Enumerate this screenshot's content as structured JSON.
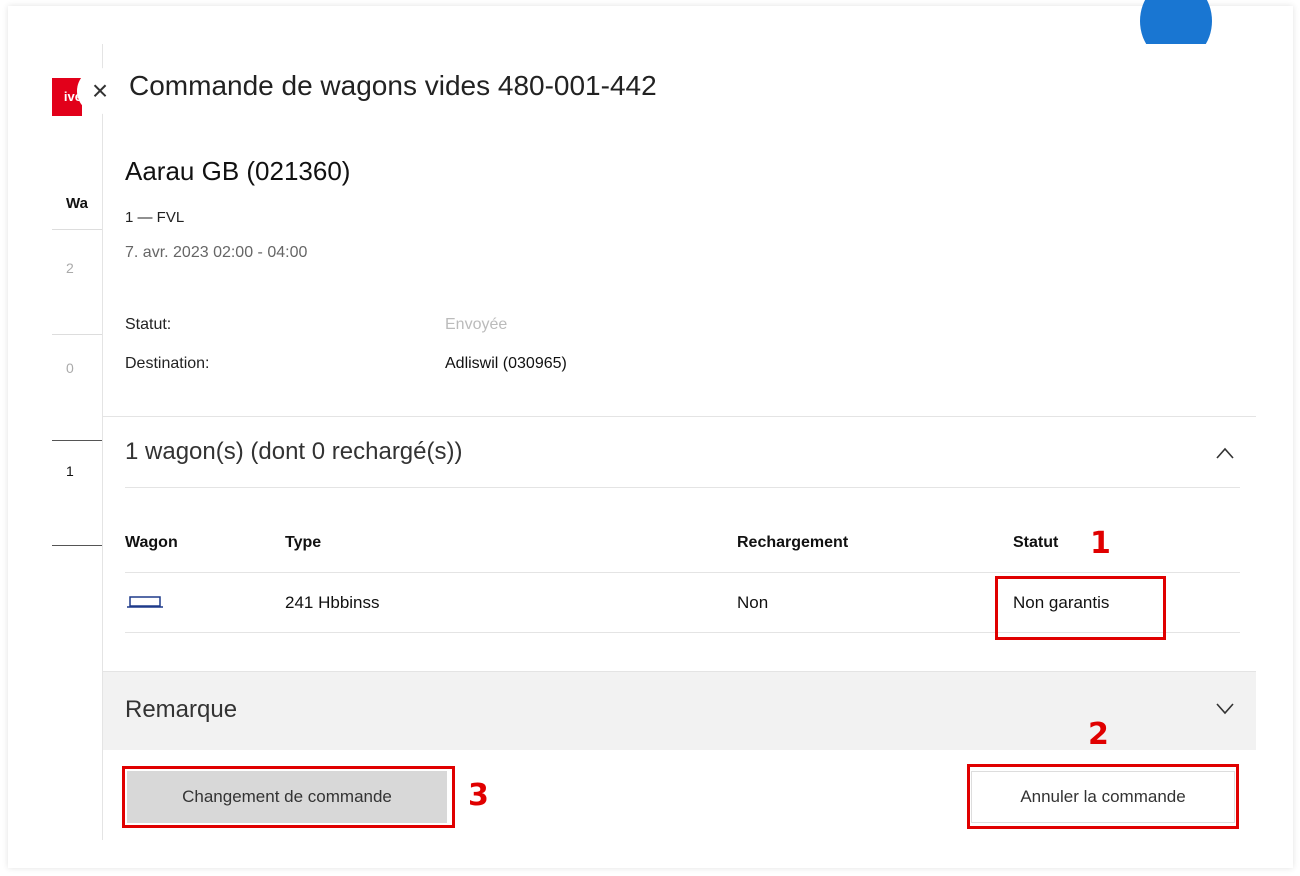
{
  "background": {
    "red_tab_text": "ive",
    "column_header": "Wa",
    "cells": [
      "2",
      "0",
      "1"
    ]
  },
  "dialog": {
    "close_icon": "close-icon",
    "title": "Commande de wagons vides 480-001-442",
    "station": "Aarau GB (021360)",
    "line": "1 — FVL",
    "date_time": "7. avr. 2023  02:00 - 04:00",
    "status_label": "Statut:",
    "status_value": "Envoyée",
    "destination_label": "Destination:",
    "destination_value": "Adliswil (030965)"
  },
  "wagons": {
    "section_title": "1 wagon(s) (dont 0 rechargé(s))",
    "toggle_icon": "chevron-up-icon",
    "columns": [
      "Wagon",
      "Type",
      "Rechargement",
      "Statut"
    ],
    "rows": [
      {
        "wagon_icon": "wagon-icon",
        "type": "241 Hbbinss",
        "rechargement": "Non",
        "statut": "Non garantis"
      }
    ]
  },
  "remarque": {
    "title": "Remarque",
    "toggle_icon": "chevron-down-icon"
  },
  "actions": {
    "change_label": "Changement de commande",
    "cancel_label": "Annuler la commande"
  },
  "annotations": [
    "1",
    "2",
    "3"
  ],
  "colors": {
    "accent_red": "#e2001a",
    "annotation_red": "#e00000",
    "blue": "#1976d2",
    "button_grey": "#d8d8d8"
  }
}
